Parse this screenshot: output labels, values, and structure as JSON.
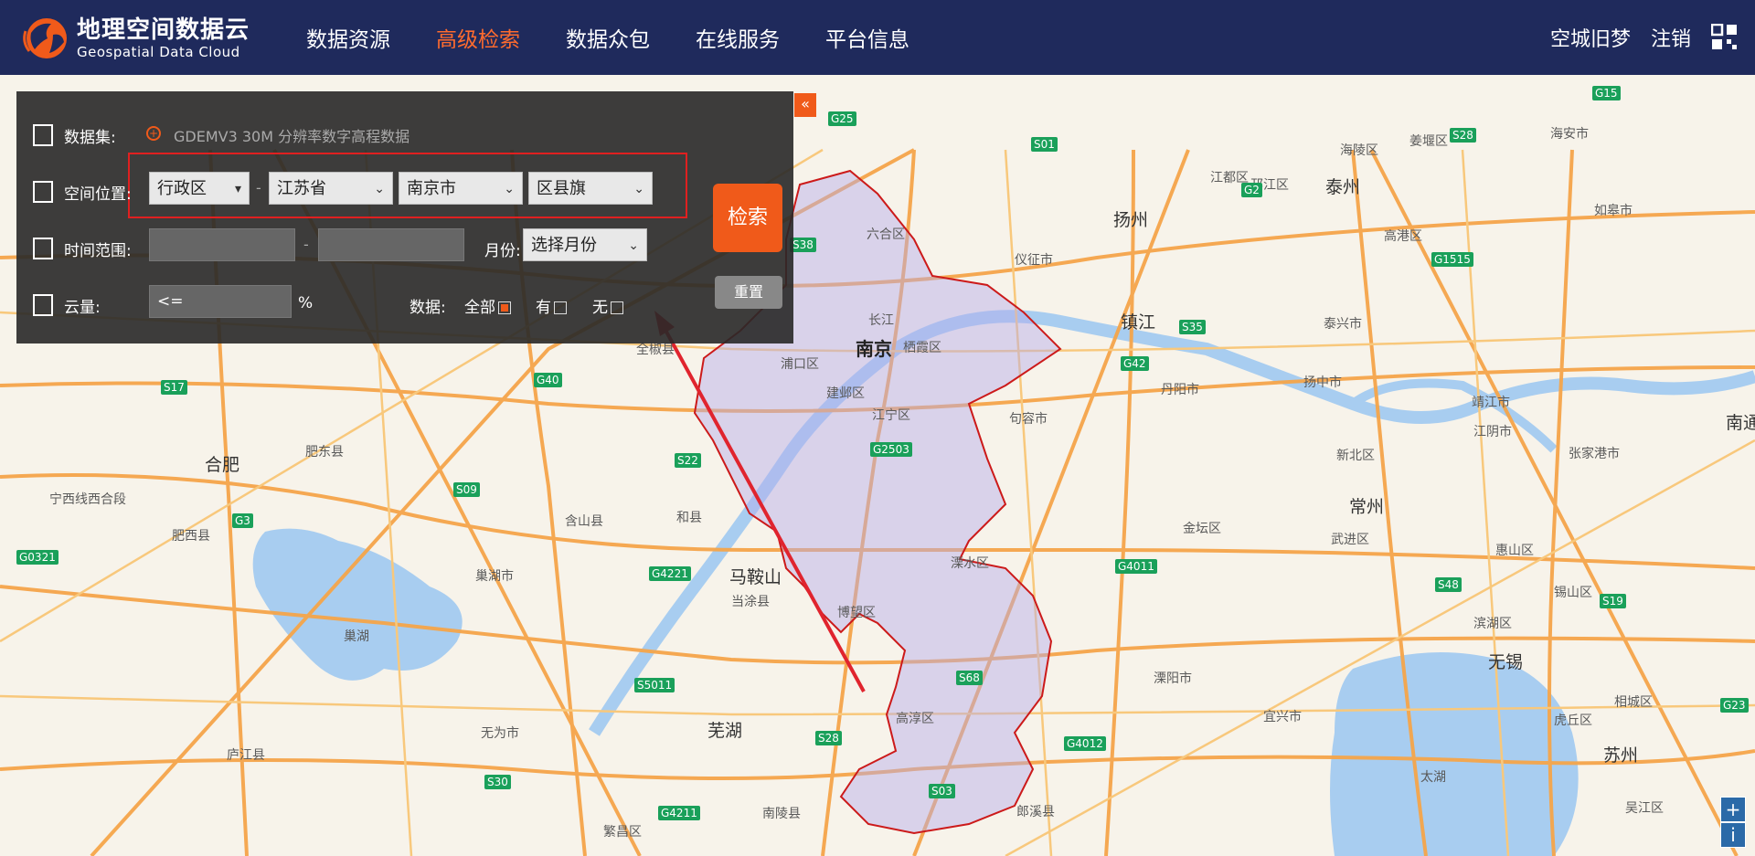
{
  "header": {
    "logo_cn": "地理空间数据云",
    "logo_en": "Geospatial Data Cloud",
    "nav": [
      "数据资源",
      "高级检索",
      "数据众包",
      "在线服务",
      "平台信息"
    ],
    "active_nav": "高级检索",
    "user_name": "空城旧梦",
    "logout": "注销"
  },
  "panel": {
    "dataset_label": "数据集:",
    "dataset_value": "GDEMV3 30M 分辨率数字高程数据",
    "location_label": "空间位置:",
    "location_type": "行政区",
    "province": "江苏省",
    "city": "南京市",
    "county": "区县旗",
    "time_label": "时间范围:",
    "time_sep": "-",
    "loc_sep": "-",
    "month_label": "月份:",
    "month_select": "选择月份",
    "cloud_label": "云量:",
    "cloud_value": "<=",
    "cloud_unit": "%",
    "data_label": "数据:",
    "opt_all": "全部",
    "opt_has": "有",
    "opt_none": "无",
    "search_btn": "检索",
    "reset_btn": "重置",
    "collapse": "«"
  },
  "map": {
    "cities": [
      {
        "name": "南京"
      },
      {
        "name": "合肥"
      },
      {
        "name": "扬州"
      },
      {
        "name": "镇江"
      },
      {
        "name": "泰州"
      },
      {
        "name": "马鞍山"
      },
      {
        "name": "芜湖"
      },
      {
        "name": "常州"
      },
      {
        "name": "无锡"
      },
      {
        "name": "苏州"
      }
    ],
    "districts": [
      "六合区",
      "栖霞区",
      "浦口区",
      "建邺区",
      "江宁区",
      "溧水区",
      "博望区",
      "高淳区",
      "句容市",
      "丹阳市",
      "仪征市",
      "当涂县",
      "和县",
      "含山县",
      "巢湖市",
      "肥东县",
      "肥西县",
      "庐江县",
      "无为市",
      "繁昌区",
      "南陵县",
      "金坛区",
      "溧阳市",
      "宜兴市",
      "武进区",
      "新北区",
      "江阴市",
      "张家港市",
      "惠山区",
      "滨湖区",
      "锡山区",
      "相城区",
      "吴江区",
      "虎丘区",
      "太湖",
      "巢湖",
      "全椒县",
      "扬中市",
      "泰兴市",
      "高港区",
      "江都区",
      "海陵区",
      "姜堰区",
      "海安市",
      "如皋市",
      "靖江市",
      "邗江区",
      "芜湖",
      "郎溪县",
      "南通",
      "宁西线西合段",
      "邗江区",
      "长江"
    ],
    "shields": [
      "G25",
      "S01",
      "G15",
      "S28",
      "G2",
      "G1515",
      "S35",
      "G42",
      "G40",
      "S17",
      "G3",
      "S22",
      "S09",
      "G4221",
      "G0321",
      "S30",
      "G4211",
      "S5011",
      "G2503",
      "S68",
      "S03",
      "G4012",
      "G4011",
      "S48",
      "S19",
      "G23",
      "S38",
      "S28"
    ],
    "zoom_in": "+",
    "zoom_info": "i"
  }
}
